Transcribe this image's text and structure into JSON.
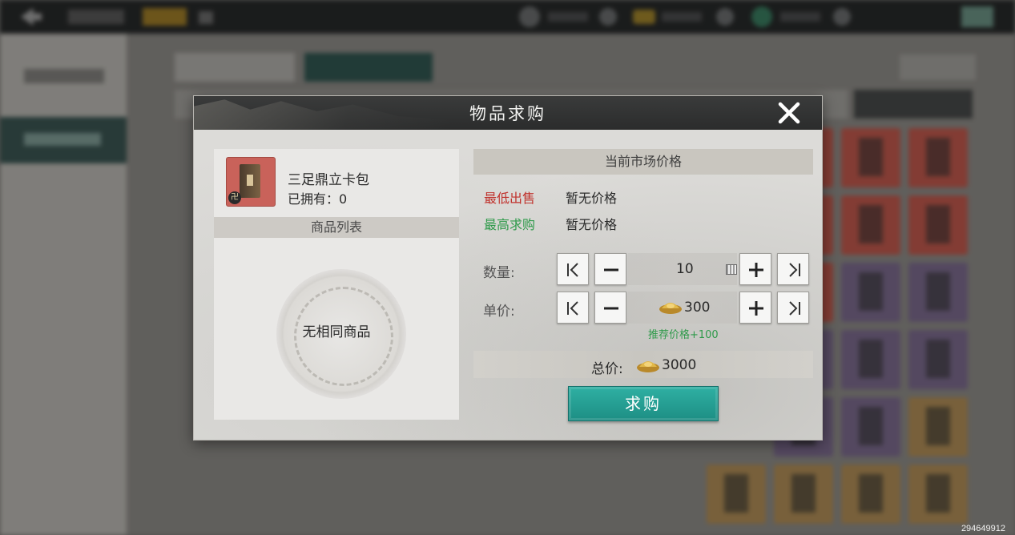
{
  "dialog": {
    "title": "物品求购",
    "close_icon": "close-x-icon"
  },
  "item": {
    "name": "三足鼎立卡包",
    "owned": "已拥有：0",
    "badge": "卍",
    "icon": "card-pack-icon"
  },
  "listing": {
    "header": "商品列表",
    "empty_text": "无相同商品"
  },
  "market": {
    "header": "当前市场价格",
    "lowest_sell_label": "最低出售",
    "lowest_sell_value": "暂无价格",
    "highest_buy_label": "最高求购",
    "highest_buy_value": "暂无价格"
  },
  "quantity": {
    "label": "数量:",
    "value": "10"
  },
  "unit_price": {
    "label": "单价:",
    "value": "300",
    "recommend": "推荐价格+100"
  },
  "total": {
    "label": "总价:",
    "value": "3000"
  },
  "buy_button": "求购",
  "watermark": "294649912",
  "colors": {
    "accent_teal": "#1d8e84",
    "sell_red": "#c0332d",
    "buy_green": "#2e9a4a"
  }
}
